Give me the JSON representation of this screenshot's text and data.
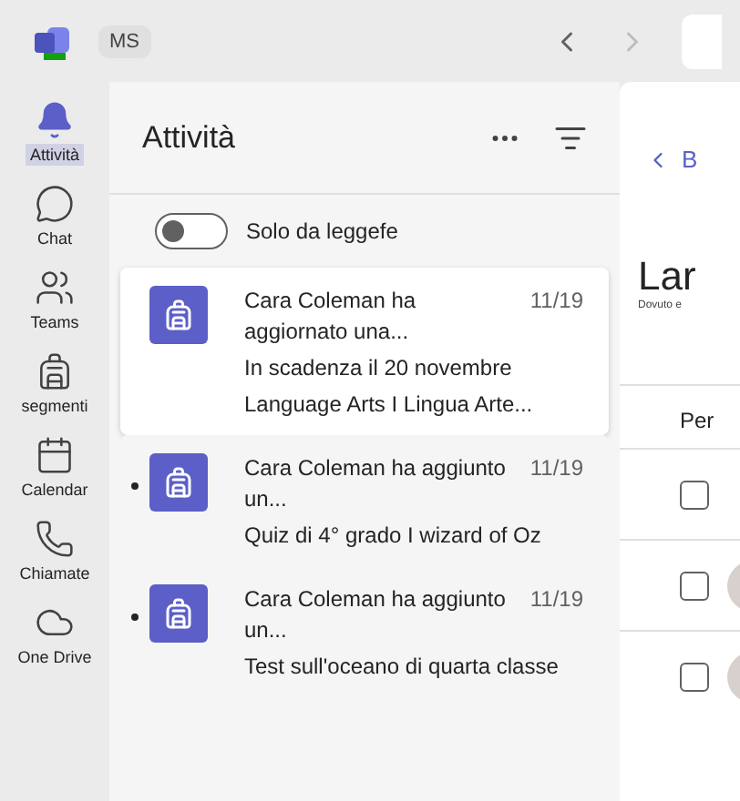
{
  "top_bar": {
    "badge": "MS"
  },
  "rail": [
    {
      "label": "Attività",
      "selected": true
    },
    {
      "label": "Chat",
      "selected": false
    },
    {
      "label": "Teams",
      "selected": false
    },
    {
      "label": "segmenti",
      "selected": false
    },
    {
      "label": "Calendar",
      "selected": false
    },
    {
      "label": "Chiamate",
      "selected": false
    },
    {
      "label": "One Drive",
      "selected": false
    }
  ],
  "activity": {
    "title": "Attività",
    "toggle": {
      "label": "Solo da leggefe",
      "on": false
    },
    "items": [
      {
        "title": "Cara Coleman ha aggiornato una...",
        "date": "11/19",
        "lines": [
          "In scadenza il 20 novembre",
          "Language Arts I Lingua Arte..."
        ],
        "selected": true,
        "unread": false
      },
      {
        "title": "Cara Coleman ha aggiunto un...",
        "date": "11/19",
        "lines": [
          "Quiz di 4° grado I wizard of Oz"
        ],
        "selected": false,
        "unread": true
      },
      {
        "title": "Cara Coleman ha aggiunto un...",
        "date": "11/19",
        "lines": [
          "Test sull'oceano di quarta classe"
        ],
        "selected": false,
        "unread": true
      }
    ]
  },
  "detail": {
    "back": "B",
    "title": "Lar",
    "subtitle": "Dovuto e",
    "column": "Per",
    "rows": [
      {
        "checked": false,
        "avatar": false
      },
      {
        "checked": false,
        "avatar": true
      },
      {
        "checked": false,
        "avatar": true
      }
    ]
  }
}
